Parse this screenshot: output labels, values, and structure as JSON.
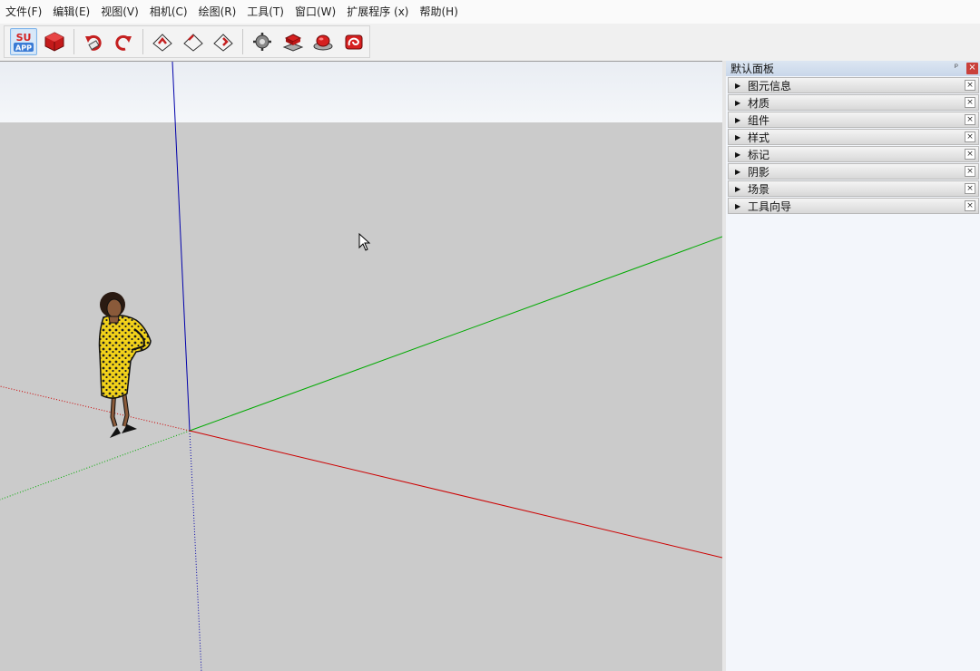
{
  "menu": [
    "文件(F)",
    "编辑(E)",
    "视图(V)",
    "相机(C)",
    "绘图(R)",
    "工具(T)",
    "窗口(W)",
    "扩展程序 (x)",
    "帮助(H)"
  ],
  "toolbar": {
    "suapp_line1": "SU",
    "suapp_line2": "APP",
    "icons": [
      "suapp-icon",
      "ruby-cube-icon",
      "undo-icon",
      "redo-icon",
      "view-tool-1-icon",
      "view-tool-2-icon",
      "view-tool-3-icon",
      "gear-settings-icon",
      "red-stack-icon",
      "red-button-icon",
      "red-spiral-icon"
    ]
  },
  "tray": {
    "title": "默认面板",
    "pin": "ᵖ",
    "close": "×",
    "panels": [
      "图元信息",
      "材质",
      "组件",
      "样式",
      "标记",
      "阴影",
      "场景",
      "工具向导"
    ],
    "panel_close": "×",
    "arrow": "▶"
  },
  "colors": {
    "sky": "#eef2f7",
    "ground": "#cbcbcb",
    "axis_red": "#cc0000",
    "axis_green": "#00aa00",
    "axis_blue": "#0000aa"
  }
}
